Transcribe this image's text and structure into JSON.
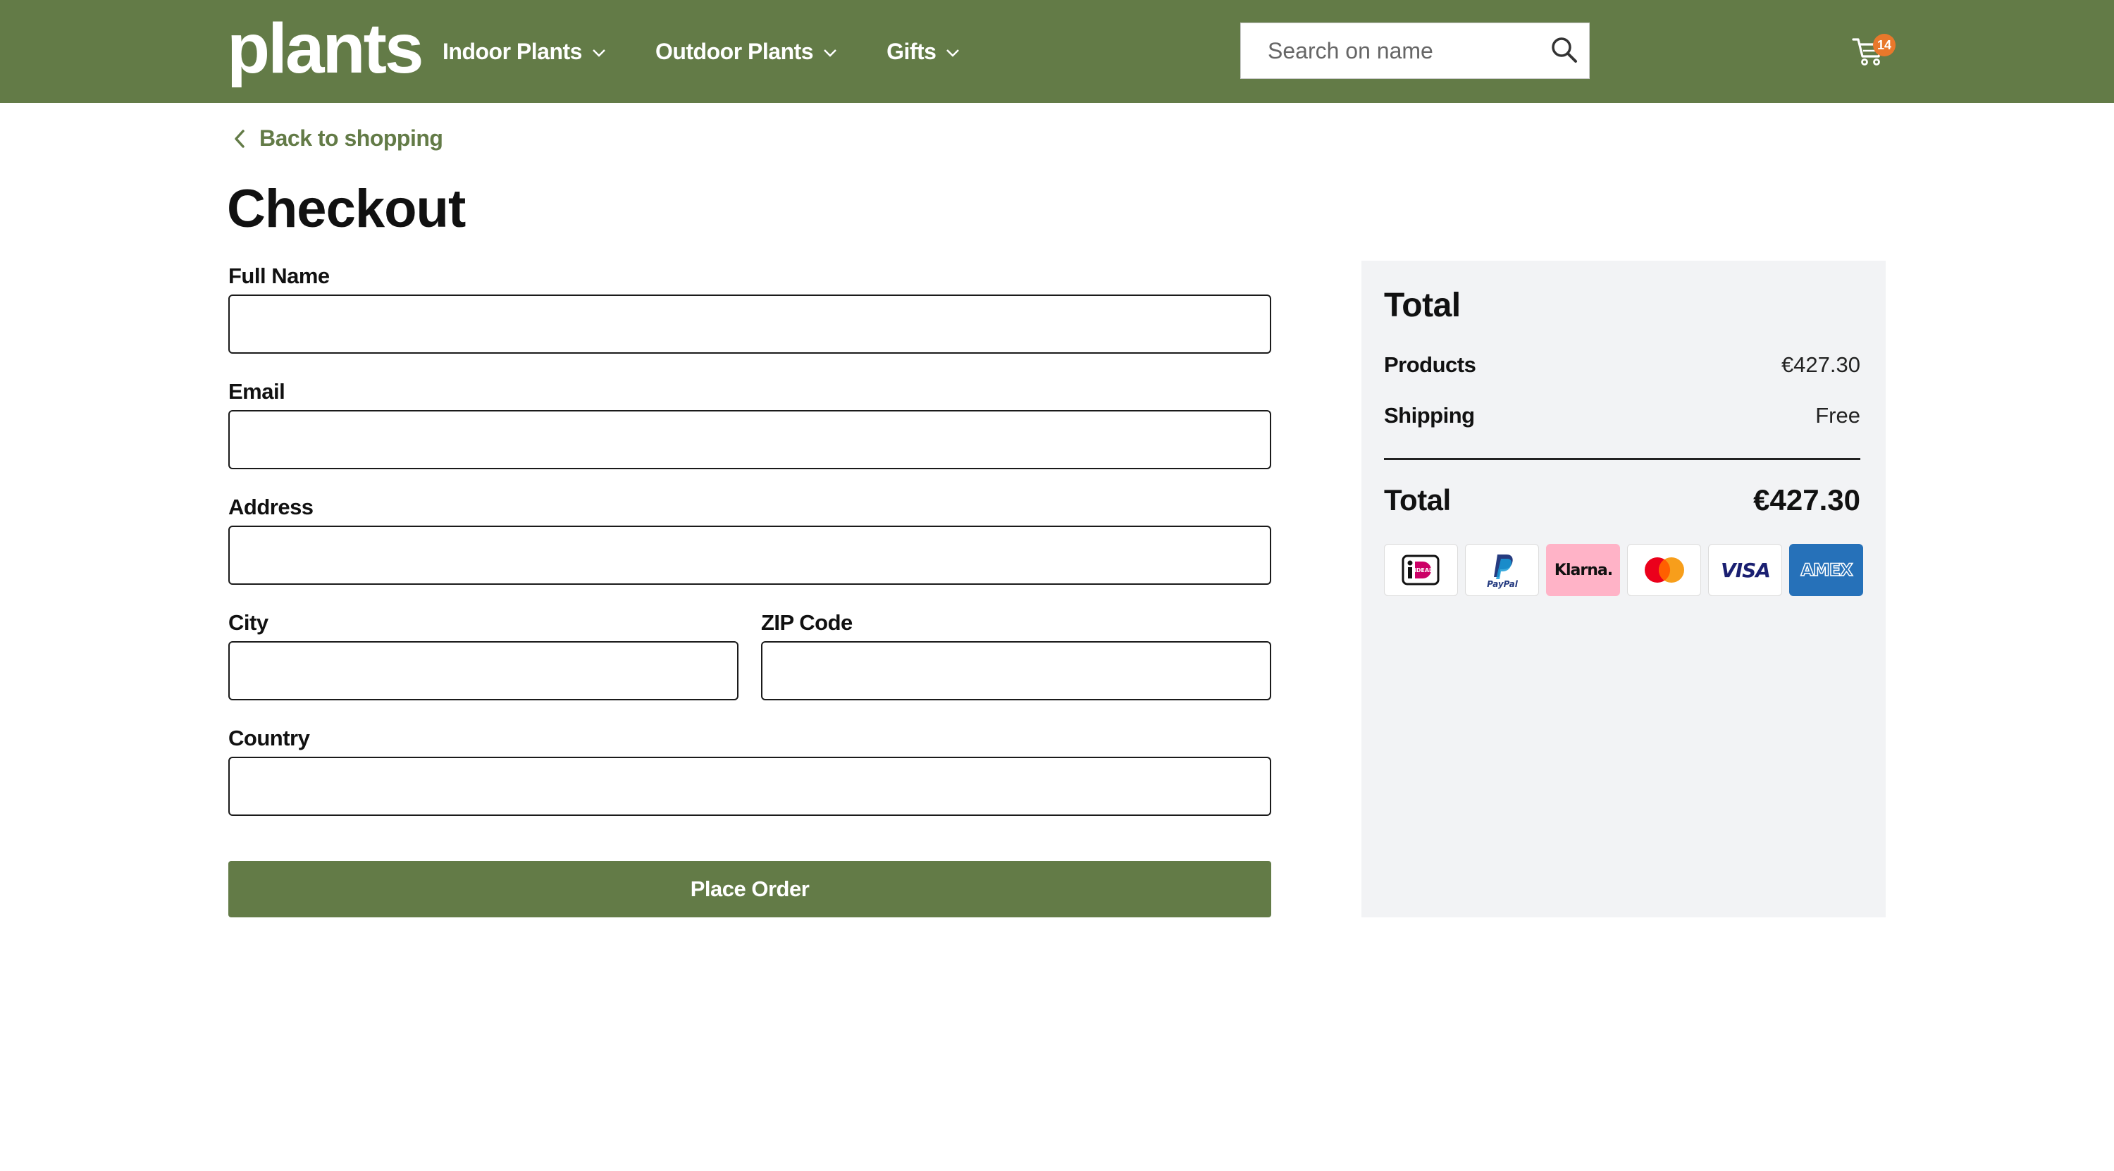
{
  "header": {
    "logo": "plants",
    "nav": [
      {
        "label": "Indoor Plants"
      },
      {
        "label": "Outdoor Plants"
      },
      {
        "label": "Gifts"
      }
    ],
    "search_placeholder": "Search on name",
    "cart_count": "14"
  },
  "main": {
    "back_label": "Back to shopping",
    "title": "Checkout",
    "fields": {
      "full_name": {
        "label": "Full Name",
        "value": ""
      },
      "email": {
        "label": "Email",
        "value": ""
      },
      "address": {
        "label": "Address",
        "value": ""
      },
      "city": {
        "label": "City",
        "value": ""
      },
      "zip": {
        "label": "ZIP Code",
        "value": ""
      },
      "country": {
        "label": "Country",
        "value": ""
      }
    },
    "place_order_label": "Place Order"
  },
  "summary": {
    "title": "Total",
    "products_label": "Products",
    "products_value": "€427.30",
    "shipping_label": "Shipping",
    "shipping_value": "Free",
    "total_label": "Total",
    "total_value": "€427.30",
    "payment_methods": [
      {
        "name": "ideal-icon",
        "text": "iDEAL"
      },
      {
        "name": "paypal-icon",
        "text": "PayPal"
      },
      {
        "name": "klarna-icon",
        "text": "Klarna."
      },
      {
        "name": "mastercard-icon",
        "text": ""
      },
      {
        "name": "visa-icon",
        "text": "VISA"
      },
      {
        "name": "amex-icon",
        "text": "AMEX"
      }
    ]
  },
  "colors": {
    "brand_green": "#637b47",
    "badge_orange": "#e8782b",
    "summary_bg": "#f2f3f5"
  }
}
